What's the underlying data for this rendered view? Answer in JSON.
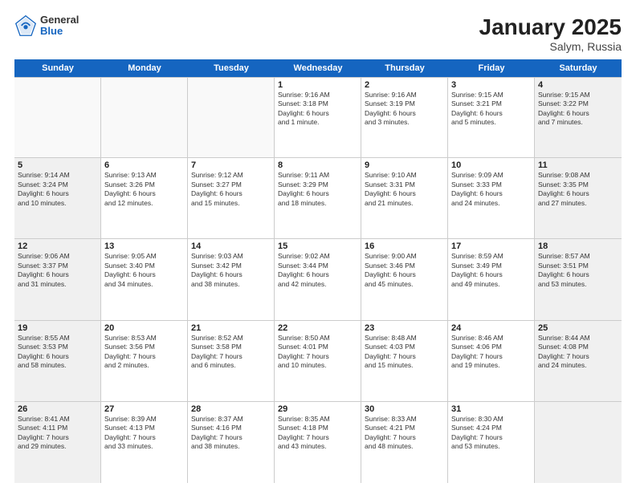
{
  "header": {
    "logo": {
      "general": "General",
      "blue": "Blue"
    },
    "title": "January 2025",
    "location": "Salym, Russia"
  },
  "days_of_week": [
    "Sunday",
    "Monday",
    "Tuesday",
    "Wednesday",
    "Thursday",
    "Friday",
    "Saturday"
  ],
  "weeks": [
    [
      {
        "day": "",
        "text": "",
        "empty": true
      },
      {
        "day": "",
        "text": "",
        "empty": true
      },
      {
        "day": "",
        "text": "",
        "empty": true
      },
      {
        "day": "1",
        "text": "Sunrise: 9:16 AM\nSunset: 3:18 PM\nDaylight: 6 hours\nand 1 minute.",
        "empty": false
      },
      {
        "day": "2",
        "text": "Sunrise: 9:16 AM\nSunset: 3:19 PM\nDaylight: 6 hours\nand 3 minutes.",
        "empty": false
      },
      {
        "day": "3",
        "text": "Sunrise: 9:15 AM\nSunset: 3:21 PM\nDaylight: 6 hours\nand 5 minutes.",
        "empty": false
      },
      {
        "day": "4",
        "text": "Sunrise: 9:15 AM\nSunset: 3:22 PM\nDaylight: 6 hours\nand 7 minutes.",
        "empty": false,
        "shaded": true
      }
    ],
    [
      {
        "day": "5",
        "text": "Sunrise: 9:14 AM\nSunset: 3:24 PM\nDaylight: 6 hours\nand 10 minutes.",
        "empty": false,
        "shaded": true
      },
      {
        "day": "6",
        "text": "Sunrise: 9:13 AM\nSunset: 3:26 PM\nDaylight: 6 hours\nand 12 minutes.",
        "empty": false
      },
      {
        "day": "7",
        "text": "Sunrise: 9:12 AM\nSunset: 3:27 PM\nDaylight: 6 hours\nand 15 minutes.",
        "empty": false
      },
      {
        "day": "8",
        "text": "Sunrise: 9:11 AM\nSunset: 3:29 PM\nDaylight: 6 hours\nand 18 minutes.",
        "empty": false
      },
      {
        "day": "9",
        "text": "Sunrise: 9:10 AM\nSunset: 3:31 PM\nDaylight: 6 hours\nand 21 minutes.",
        "empty": false
      },
      {
        "day": "10",
        "text": "Sunrise: 9:09 AM\nSunset: 3:33 PM\nDaylight: 6 hours\nand 24 minutes.",
        "empty": false
      },
      {
        "day": "11",
        "text": "Sunrise: 9:08 AM\nSunset: 3:35 PM\nDaylight: 6 hours\nand 27 minutes.",
        "empty": false,
        "shaded": true
      }
    ],
    [
      {
        "day": "12",
        "text": "Sunrise: 9:06 AM\nSunset: 3:37 PM\nDaylight: 6 hours\nand 31 minutes.",
        "empty": false,
        "shaded": true
      },
      {
        "day": "13",
        "text": "Sunrise: 9:05 AM\nSunset: 3:40 PM\nDaylight: 6 hours\nand 34 minutes.",
        "empty": false
      },
      {
        "day": "14",
        "text": "Sunrise: 9:03 AM\nSunset: 3:42 PM\nDaylight: 6 hours\nand 38 minutes.",
        "empty": false
      },
      {
        "day": "15",
        "text": "Sunrise: 9:02 AM\nSunset: 3:44 PM\nDaylight: 6 hours\nand 42 minutes.",
        "empty": false
      },
      {
        "day": "16",
        "text": "Sunrise: 9:00 AM\nSunset: 3:46 PM\nDaylight: 6 hours\nand 45 minutes.",
        "empty": false
      },
      {
        "day": "17",
        "text": "Sunrise: 8:59 AM\nSunset: 3:49 PM\nDaylight: 6 hours\nand 49 minutes.",
        "empty": false
      },
      {
        "day": "18",
        "text": "Sunrise: 8:57 AM\nSunset: 3:51 PM\nDaylight: 6 hours\nand 53 minutes.",
        "empty": false,
        "shaded": true
      }
    ],
    [
      {
        "day": "19",
        "text": "Sunrise: 8:55 AM\nSunset: 3:53 PM\nDaylight: 6 hours\nand 58 minutes.",
        "empty": false,
        "shaded": true
      },
      {
        "day": "20",
        "text": "Sunrise: 8:53 AM\nSunset: 3:56 PM\nDaylight: 7 hours\nand 2 minutes.",
        "empty": false
      },
      {
        "day": "21",
        "text": "Sunrise: 8:52 AM\nSunset: 3:58 PM\nDaylight: 7 hours\nand 6 minutes.",
        "empty": false
      },
      {
        "day": "22",
        "text": "Sunrise: 8:50 AM\nSunset: 4:01 PM\nDaylight: 7 hours\nand 10 minutes.",
        "empty": false
      },
      {
        "day": "23",
        "text": "Sunrise: 8:48 AM\nSunset: 4:03 PM\nDaylight: 7 hours\nand 15 minutes.",
        "empty": false
      },
      {
        "day": "24",
        "text": "Sunrise: 8:46 AM\nSunset: 4:06 PM\nDaylight: 7 hours\nand 19 minutes.",
        "empty": false
      },
      {
        "day": "25",
        "text": "Sunrise: 8:44 AM\nSunset: 4:08 PM\nDaylight: 7 hours\nand 24 minutes.",
        "empty": false,
        "shaded": true
      }
    ],
    [
      {
        "day": "26",
        "text": "Sunrise: 8:41 AM\nSunset: 4:11 PM\nDaylight: 7 hours\nand 29 minutes.",
        "empty": false,
        "shaded": true
      },
      {
        "day": "27",
        "text": "Sunrise: 8:39 AM\nSunset: 4:13 PM\nDaylight: 7 hours\nand 33 minutes.",
        "empty": false
      },
      {
        "day": "28",
        "text": "Sunrise: 8:37 AM\nSunset: 4:16 PM\nDaylight: 7 hours\nand 38 minutes.",
        "empty": false
      },
      {
        "day": "29",
        "text": "Sunrise: 8:35 AM\nSunset: 4:18 PM\nDaylight: 7 hours\nand 43 minutes.",
        "empty": false
      },
      {
        "day": "30",
        "text": "Sunrise: 8:33 AM\nSunset: 4:21 PM\nDaylight: 7 hours\nand 48 minutes.",
        "empty": false
      },
      {
        "day": "31",
        "text": "Sunrise: 8:30 AM\nSunset: 4:24 PM\nDaylight: 7 hours\nand 53 minutes.",
        "empty": false
      },
      {
        "day": "",
        "text": "",
        "empty": true,
        "shaded": true
      }
    ]
  ]
}
